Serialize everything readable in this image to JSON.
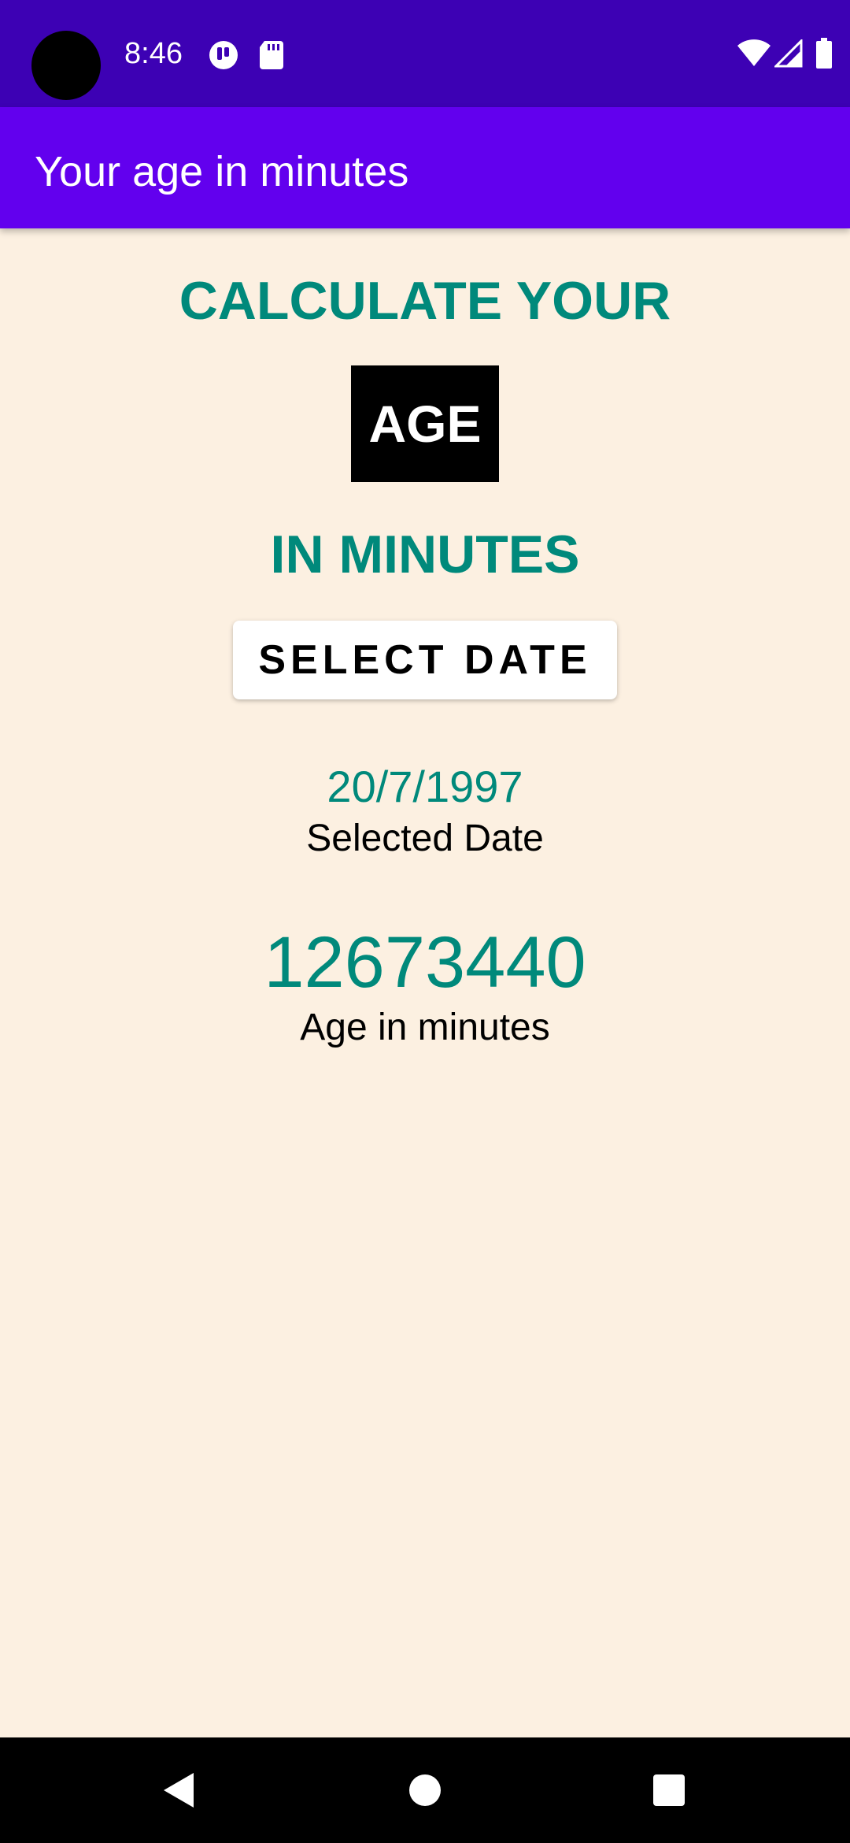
{
  "status_bar": {
    "time": "8:46",
    "icons": [
      "camera-hole",
      "privacy-indicator-icon",
      "sd-card-icon",
      "wifi-icon",
      "signal-icon",
      "battery-icon"
    ]
  },
  "app_bar": {
    "title": "Your age in minutes",
    "color": "#6200ee",
    "status_color": "#3d01b4"
  },
  "main": {
    "heading_top": "CALCULATE YOUR",
    "heading_box": "AGE",
    "heading_bottom": "IN MINUTES",
    "select_button_label": "SELECT DATE",
    "selected_date_value": "20/7/1997",
    "selected_date_label": "Selected Date",
    "age_minutes_value": "12673440",
    "age_minutes_label": "Age in minutes",
    "accent_color": "#00897b",
    "background_color": "#fcf0e1"
  },
  "nav_bar": {
    "buttons": [
      "back-icon",
      "home-icon",
      "recents-icon"
    ]
  }
}
